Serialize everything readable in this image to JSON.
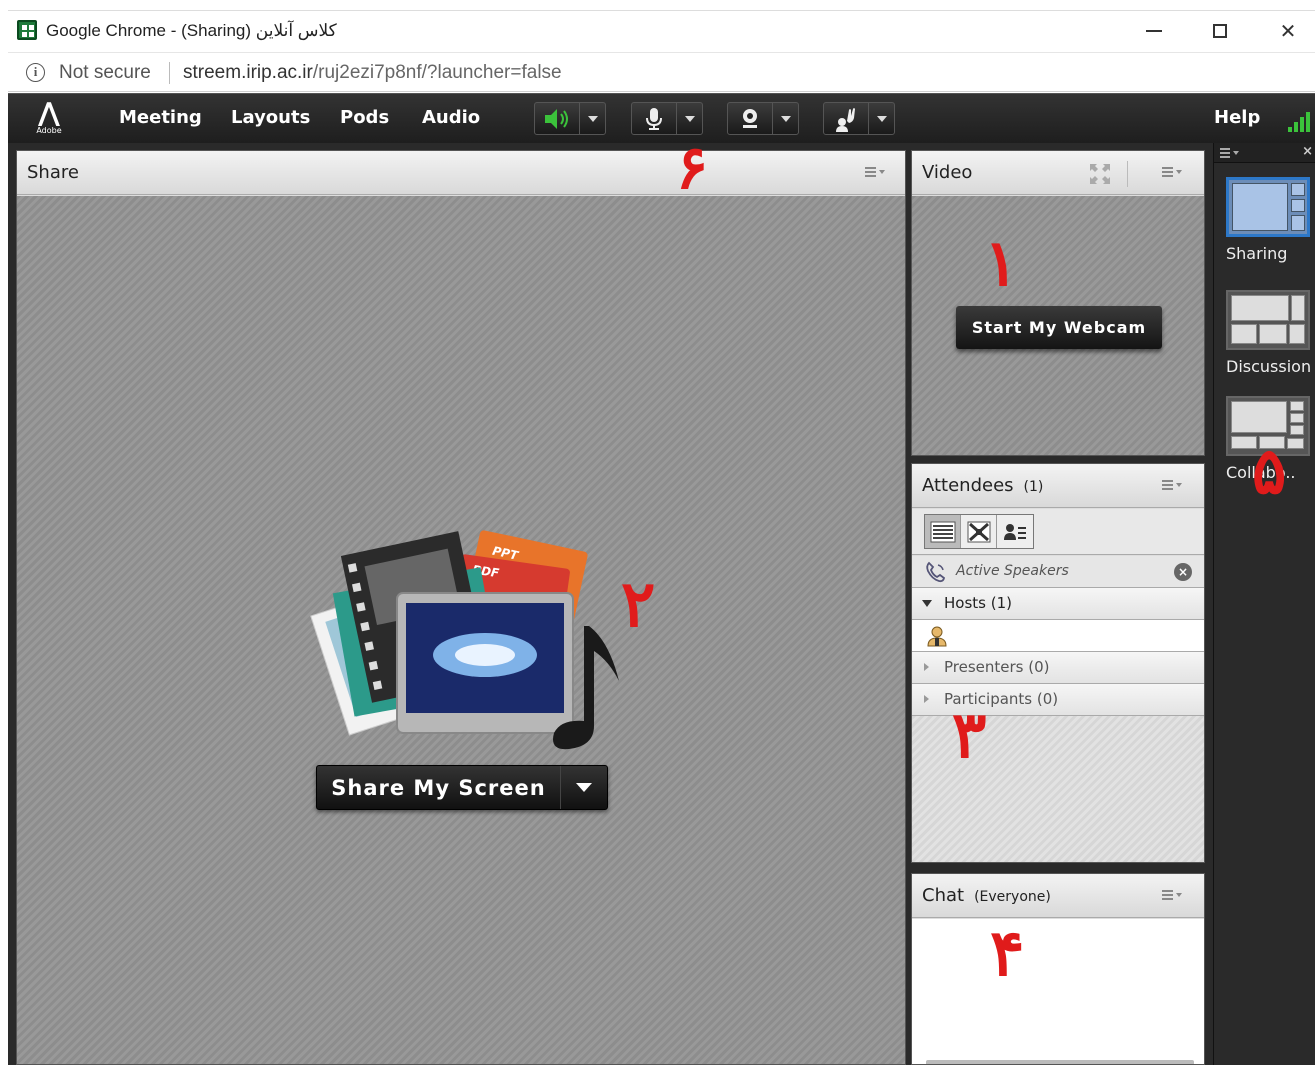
{
  "browser": {
    "title": "Google Chrome - (Sharing) کلاس آنلاین",
    "security_label": "Not secure",
    "url_host": "streem.irip.ac.ir",
    "url_path": "/ruj2ezi7p8nf/?launcher=false"
  },
  "connect": {
    "logo_word": "Adobe",
    "menu": [
      "Meeting",
      "Layouts",
      "Pods",
      "Audio"
    ],
    "help_label": "Help"
  },
  "share_pod": {
    "title": "Share",
    "button_label": "Share My Screen",
    "icon_tags": [
      "PPT",
      "PDF"
    ]
  },
  "video_pod": {
    "title": "Video",
    "button_label": "Start My Webcam"
  },
  "attendees_pod": {
    "title": "Attendees",
    "count": "(1)",
    "active_speakers": "Active Speakers",
    "groups": {
      "hosts": "Hosts (1)",
      "presenters": "Presenters (0)",
      "participants": "Participants (0)"
    }
  },
  "chat_pod": {
    "title": "Chat",
    "scope": "(Everyone)"
  },
  "layouts": {
    "items": [
      {
        "label": "Sharing",
        "selected": true
      },
      {
        "label": "Discussion",
        "selected": false
      },
      {
        "label": "Collabo..",
        "selected": false
      }
    ]
  },
  "annotations": {
    "n1": "١",
    "n2": "٢",
    "n3": "٣",
    "n4": "۴",
    "n5": "۵",
    "n6": "۶"
  },
  "colors": {
    "menubar": "#222222",
    "annotation_red": "#e01b1b",
    "selected_layout": "#2d78c8",
    "audio_green": "#3bc23b"
  }
}
